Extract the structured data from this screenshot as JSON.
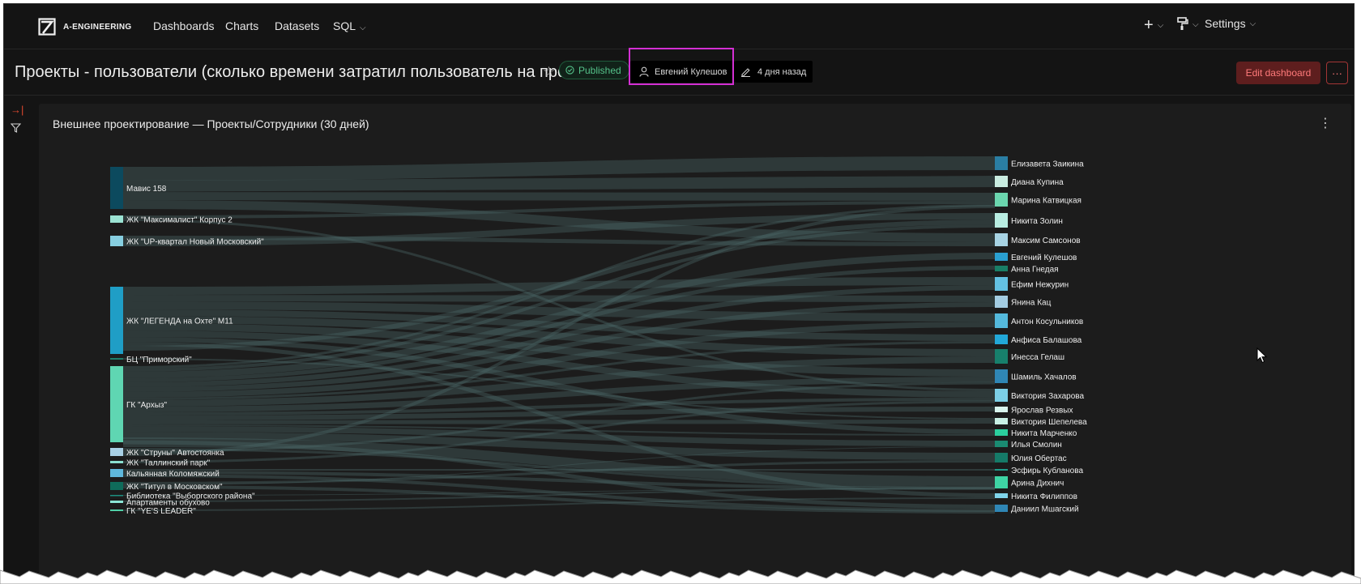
{
  "nav": {
    "brand": "A-ENGINEERING",
    "items": [
      {
        "label": "Dashboards"
      },
      {
        "label": "Charts"
      },
      {
        "label": "Datasets"
      },
      {
        "label": "SQL"
      }
    ],
    "right": {
      "add_icon": "plus-icon",
      "theme_icon": "paint-roller-icon",
      "settings_label": "Settings"
    }
  },
  "dashboard": {
    "title": "Проекты - пользователи (сколько времени затратил пользователь на прое…",
    "status": "Published",
    "owner": "Евгений Кулешов",
    "modified": "4 дня назад",
    "edit_label": "Edit dashboard",
    "more_label": "···"
  },
  "panel": {
    "title": "Внешнее проектирование — Проекты/Сотрудники (30 дней)"
  },
  "colors": {
    "background": "#141414",
    "panel": "#1c1c1c",
    "highlight": "#d42fd4",
    "published": "#55c28a",
    "edit_button": "#5e1e1e"
  },
  "chart_data": {
    "type": "sankey",
    "sources": [
      "Мавис 158",
      "ЖК \"Максималист\" Корпус 2",
      "ЖК \"UP-квартал Новый Московский\"",
      "ЖК \"ЛЕГЕНДА на Охте\" М11",
      "БЦ \"Приморский\"",
      "ГК \"Архыз\"",
      "ЖК \"Струны\" Автостоянка",
      "ЖК \"Таллинский парк\"",
      "Кальянная Коломяжский",
      "ЖК \"Титул в Московском\"",
      "Библиотека \"Выборгского района\"",
      "Апартаменты обухово",
      "ГК \"YE'S LEADER\""
    ],
    "targets": [
      "Елизавета Заикина",
      "Диана Купина",
      "Марина Катвицкая",
      "Никита Золин",
      "Максим Самсонов",
      "Евгений Кулешов",
      "Анна Гнедая",
      "Ефим Нежурин",
      "Янина Кац",
      "Антон Косульников",
      "Анфиса Балашова",
      "Инесса Гелаш",
      "Шамиль Хачалов",
      "Виктория Захарова",
      "Ярослав Резвых",
      "Виктория Шепелева",
      "Никита  Марченко",
      "Илья  Смолин",
      "Юлия Обертас",
      "Эсфирь Кубланова",
      "Арина Дихнич",
      "Никита Филиппов",
      "Даниил  Мшагский"
    ]
  }
}
